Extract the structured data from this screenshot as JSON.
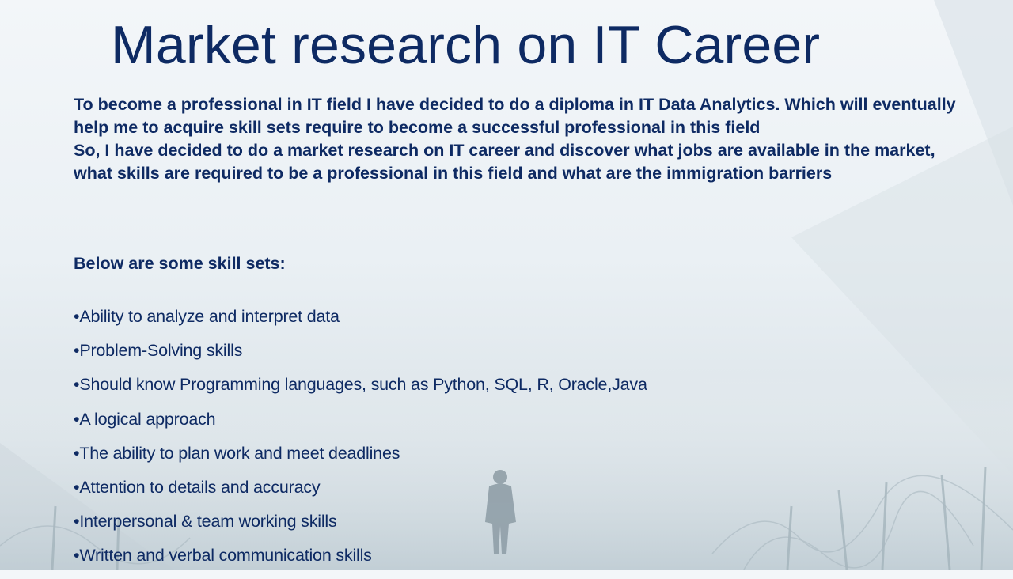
{
  "slide": {
    "title": "Market research on IT Career",
    "intro": [
      "To become a professional in IT field I have decided to do a diploma in IT Data Analytics. Which will eventually help me to acquire skill sets require to become a successful professional in this field",
      "So, I have decided to do a market research on IT career and discover what jobs are available in the market, what skills are required to be a professional in this field and what are the immigration barriers"
    ],
    "skills_heading": "Below are some skill sets:",
    "bullet": "•",
    "skills": [
      "Ability to analyze and interpret data",
      "Problem-Solving skills",
      "Should know Programming languages, such as Python, SQL, R, Oracle,Java",
      "A logical approach",
      "The ability to plan work and meet deadlines",
      "Attention to details and accuracy",
      "Interpersonal & team working skills",
      "Written and verbal communication skills"
    ]
  },
  "colors": {
    "text": "#0e2a63",
    "background": "#eaf0f4"
  },
  "background_image": "misty-field-walker"
}
